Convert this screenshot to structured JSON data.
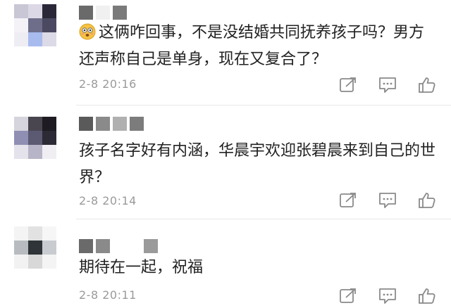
{
  "comments": [
    {
      "text": "这俩咋回事，不是没结婚共同抚养孩子吗？男方还声称自己是单身，现在又复合了？",
      "time": "2-8 20:16",
      "has_emoji": true
    },
    {
      "text": "孩子名字好有内涵，华晨宇欢迎张碧晨来到自己的世界？",
      "time": "2-8 20:14",
      "has_emoji": false
    },
    {
      "text": "期待在一起，祝福",
      "time": "2-8 20:11",
      "has_emoji": false
    }
  ],
  "icons": {
    "emoji": "flushed-face-icon",
    "share": "share-icon",
    "reply": "reply-icon",
    "like": "thumbs-up-icon"
  },
  "colors": {
    "text": "#222222",
    "meta": "#9a9a9a",
    "icon": "#8a8a8a",
    "emoji_face": "#f6c244"
  }
}
